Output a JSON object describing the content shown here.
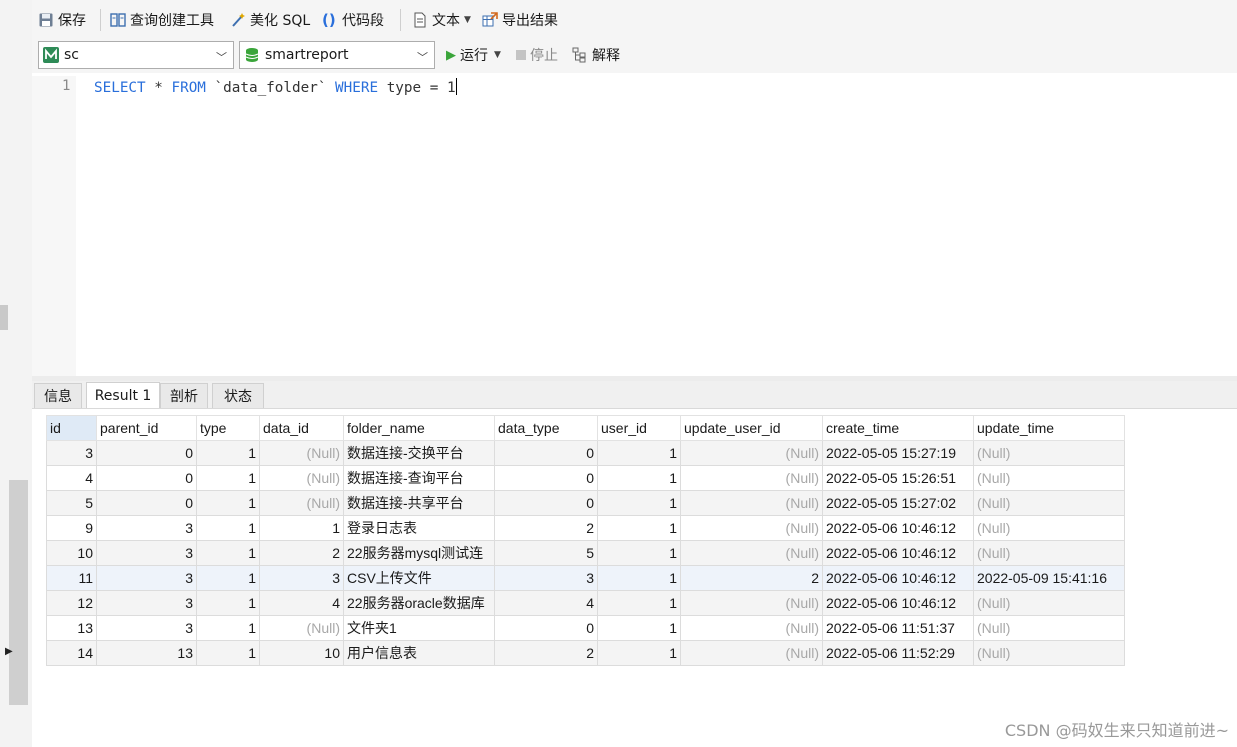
{
  "toolbar": {
    "save": "保存",
    "query_builder": "查询创建工具",
    "beautify": "美化 SQL",
    "snippet": "代码段",
    "text": "文本",
    "export": "导出结果"
  },
  "connection": {
    "value": "sc"
  },
  "database": {
    "value": "smartreport"
  },
  "actions": {
    "run": "运行",
    "stop": "停止",
    "explain": "解释"
  },
  "editor": {
    "line_number": "1",
    "tokens": {
      "select": "SELECT",
      "star": " * ",
      "from": "FROM",
      "table": " `data_folder` ",
      "where": "WHERE",
      "condition": " type = 1"
    }
  },
  "tabs": [
    "信息",
    "Result 1",
    "剖析",
    "状态"
  ],
  "active_tab": "Result 1",
  "grid": {
    "columns": [
      "id",
      "parent_id",
      "type",
      "data_id",
      "folder_name",
      "data_type",
      "user_id",
      "update_user_id",
      "create_time",
      "update_time"
    ],
    "rows": [
      [
        "3",
        "0",
        "1",
        "(Null)",
        "数据连接-交换平台",
        "0",
        "1",
        "(Null)",
        "2022-05-05 15:27:19",
        "(Null)"
      ],
      [
        "4",
        "0",
        "1",
        "(Null)",
        "数据连接-查询平台",
        "0",
        "1",
        "(Null)",
        "2022-05-05 15:26:51",
        "(Null)"
      ],
      [
        "5",
        "0",
        "1",
        "(Null)",
        "数据连接-共享平台",
        "0",
        "1",
        "(Null)",
        "2022-05-05 15:27:02",
        "(Null)"
      ],
      [
        "9",
        "3",
        "1",
        "1",
        "登录日志表",
        "2",
        "1",
        "(Null)",
        "2022-05-06 10:46:12",
        "(Null)"
      ],
      [
        "10",
        "3",
        "1",
        "2",
        "22服务器mysql测试连",
        "5",
        "1",
        "(Null)",
        "2022-05-06 10:46:12",
        "(Null)"
      ],
      [
        "11",
        "3",
        "1",
        "3",
        "CSV上传文件",
        "3",
        "1",
        "2",
        "2022-05-06 10:46:12",
        "2022-05-09 15:41:16"
      ],
      [
        "12",
        "3",
        "1",
        "4",
        "22服务器oracle数据库",
        "4",
        "1",
        "(Null)",
        "2022-05-06 10:46:12",
        "(Null)"
      ],
      [
        "13",
        "3",
        "1",
        "(Null)",
        "文件夹1",
        "0",
        "1",
        "(Null)",
        "2022-05-06 11:51:37",
        "(Null)"
      ],
      [
        "14",
        "13",
        "1",
        "10",
        "用户信息表",
        "2",
        "1",
        "(Null)",
        "2022-05-06 11:52:29",
        "(Null)"
      ]
    ],
    "highlighted_row": 5,
    "current_row": 8
  },
  "watermark": "CSDN @码奴生来只知道前进~",
  "colors": {
    "keyword": "#2a6fdb",
    "null_text": "#a8a8a8",
    "run_green": "#3aa53a"
  }
}
